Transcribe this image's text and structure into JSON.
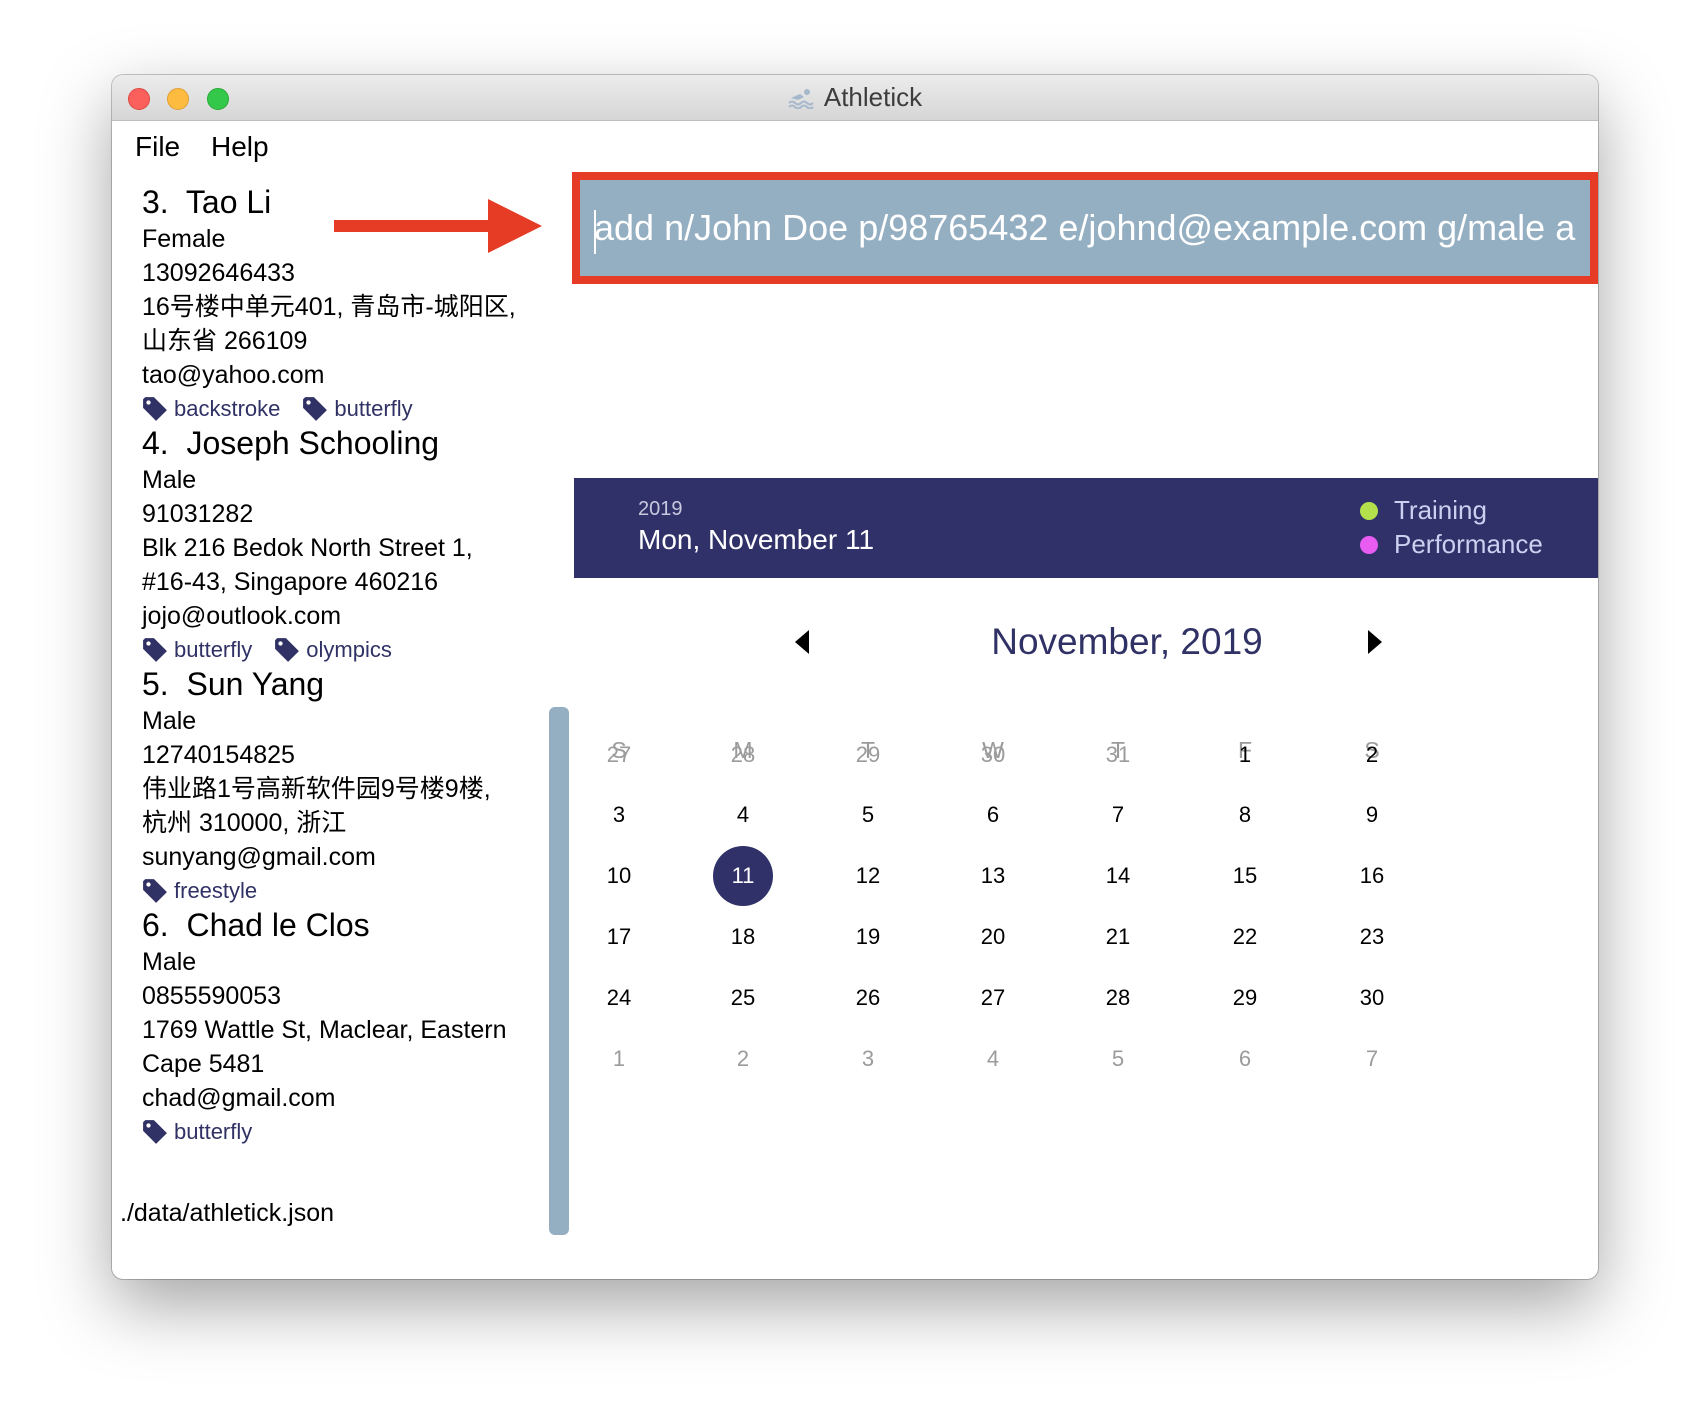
{
  "window": {
    "title": "Athletick"
  },
  "menu": {
    "file": "File",
    "help": "Help"
  },
  "persons": [
    {
      "index": "3.",
      "name": "Tao Li",
      "gender": "Female",
      "phone": "13092646433",
      "address_line1": "16号楼中单元401, 青岛市-城阳区,",
      "address_line2": "山东省 266109",
      "email": "tao@yahoo.com",
      "tags": [
        "backstroke",
        "butterfly"
      ]
    },
    {
      "index": "4.",
      "name": "Joseph Schooling",
      "gender": "Male",
      "phone": "91031282",
      "address_line1": "Blk 216 Bedok North Street 1,",
      "address_line2": "#16-43, Singapore 460216",
      "email": "jojo@outlook.com",
      "tags": [
        "butterfly",
        "olympics"
      ]
    },
    {
      "index": "5.",
      "name": "Sun Yang",
      "gender": "Male",
      "phone": "12740154825",
      "address_line1": "伟业路1号高新软件园9号楼9楼,",
      "address_line2": "杭州 310000, 浙江",
      "email": "sunyang@gmail.com",
      "tags": [
        "freestyle"
      ]
    },
    {
      "index": "6.",
      "name": "Chad le Clos",
      "gender": "Male",
      "phone": "0855590053",
      "address_line1": "1769 Wattle St, Maclear, Eastern",
      "address_line2": "Cape 5481",
      "email": "chad@gmail.com",
      "tags": [
        "butterfly"
      ]
    }
  ],
  "status": {
    "file_path": "./data/athletick.json"
  },
  "command": {
    "value": "add n/John Doe p/98765432 e/johnd@example.com g/male a"
  },
  "calendar_header": {
    "year": "2019",
    "date": "Mon, November 11",
    "legend": [
      {
        "label": "Training",
        "color": "#b4e04c"
      },
      {
        "label": "Performance",
        "color": "#e85cf2"
      }
    ]
  },
  "calendar": {
    "month_title": "November, 2019",
    "weekdays": [
      "S",
      "M",
      "T",
      "W",
      "T",
      "F",
      "S"
    ],
    "weeks": [
      [
        {
          "d": "27",
          "m": true
        },
        {
          "d": "28",
          "m": true
        },
        {
          "d": "29",
          "m": true
        },
        {
          "d": "30",
          "m": true
        },
        {
          "d": "31",
          "m": true
        },
        {
          "d": "1"
        },
        {
          "d": "2"
        }
      ],
      [
        {
          "d": "3"
        },
        {
          "d": "4"
        },
        {
          "d": "5"
        },
        {
          "d": "6"
        },
        {
          "d": "7"
        },
        {
          "d": "8"
        },
        {
          "d": "9"
        }
      ],
      [
        {
          "d": "10"
        },
        {
          "d": "11",
          "selected": true
        },
        {
          "d": "12"
        },
        {
          "d": "13"
        },
        {
          "d": "14"
        },
        {
          "d": "15"
        },
        {
          "d": "16"
        }
      ],
      [
        {
          "d": "17"
        },
        {
          "d": "18"
        },
        {
          "d": "19"
        },
        {
          "d": "20"
        },
        {
          "d": "21"
        },
        {
          "d": "22"
        },
        {
          "d": "23"
        }
      ],
      [
        {
          "d": "24"
        },
        {
          "d": "25"
        },
        {
          "d": "26"
        },
        {
          "d": "27"
        },
        {
          "d": "28"
        },
        {
          "d": "29"
        },
        {
          "d": "30"
        }
      ],
      [
        {
          "d": "1",
          "m": true
        },
        {
          "d": "2",
          "m": true
        },
        {
          "d": "3",
          "m": true
        },
        {
          "d": "4",
          "m": true
        },
        {
          "d": "5",
          "m": true
        },
        {
          "d": "6",
          "m": true
        },
        {
          "d": "7",
          "m": true
        }
      ]
    ]
  },
  "colors": {
    "accent": "#303169",
    "highlight": "#e63b24",
    "command_bg": "#94aec2"
  }
}
